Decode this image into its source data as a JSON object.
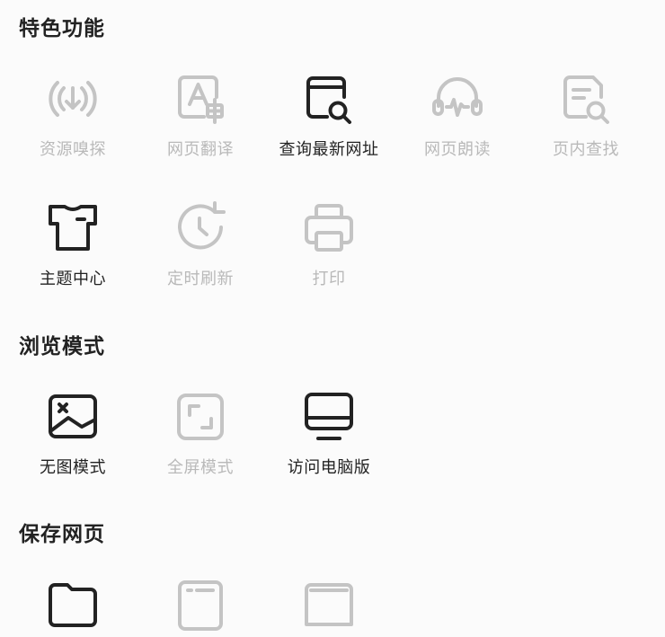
{
  "sections": {
    "features": {
      "title": "特色功能",
      "items": [
        {
          "label": "资源嗅探",
          "icon": "resource-sniff-icon",
          "enabled": false
        },
        {
          "label": "网页翻译",
          "icon": "translate-icon",
          "enabled": false
        },
        {
          "label": "查询最新网址",
          "icon": "browser-search-icon",
          "enabled": true
        },
        {
          "label": "网页朗读",
          "icon": "headphones-icon",
          "enabled": false
        },
        {
          "label": "页内查找",
          "icon": "page-search-icon",
          "enabled": false
        },
        {
          "label": "主题中心",
          "icon": "tshirt-icon",
          "enabled": true
        },
        {
          "label": "定时刷新",
          "icon": "clock-refresh-icon",
          "enabled": false
        },
        {
          "label": "打印",
          "icon": "printer-icon",
          "enabled": false
        }
      ]
    },
    "browse_mode": {
      "title": "浏览模式",
      "items": [
        {
          "label": "无图模式",
          "icon": "no-image-icon",
          "enabled": true
        },
        {
          "label": "全屏模式",
          "icon": "fullscreen-icon",
          "enabled": false
        },
        {
          "label": "访问电脑版",
          "icon": "desktop-icon",
          "enabled": true
        }
      ]
    },
    "save_page": {
      "title": "保存网页"
    }
  },
  "colors": {
    "enabled": "#222222",
    "disabled": "#c4c4c4",
    "background": "#fbfbfb"
  }
}
